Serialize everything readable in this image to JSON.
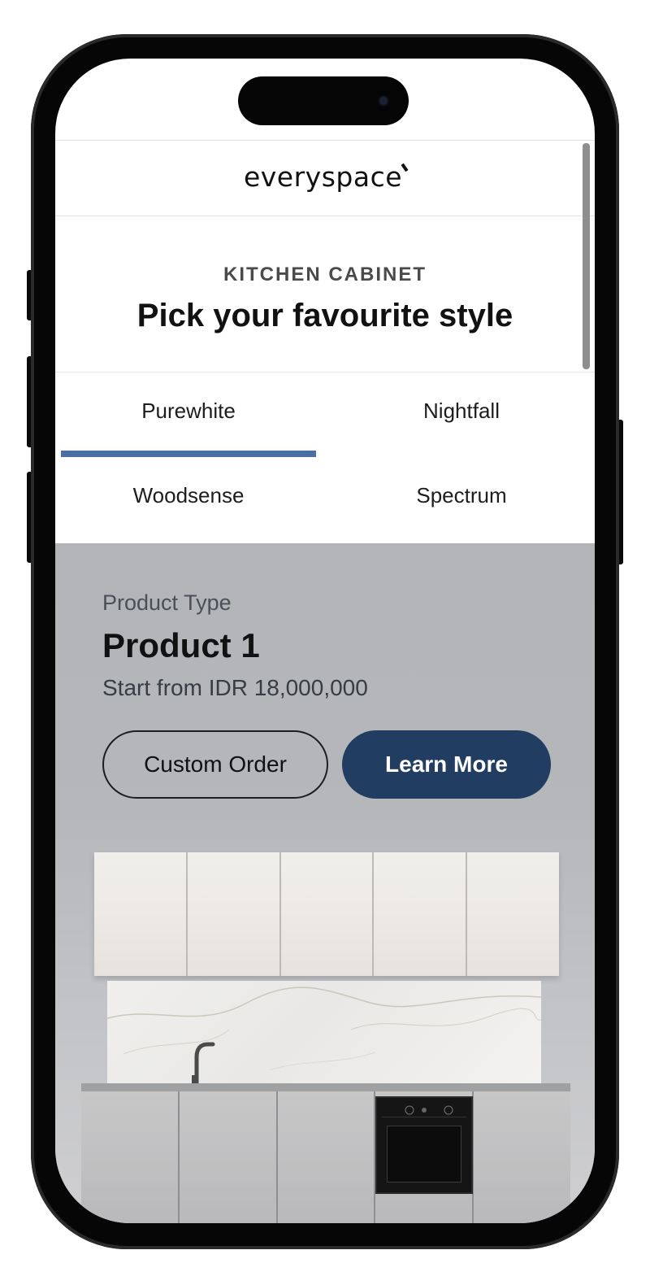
{
  "app": {
    "logo_text": "everyspace"
  },
  "intro": {
    "eyebrow": "KITCHEN CABINET",
    "headline": "Pick your favourite style"
  },
  "tabs": [
    {
      "label": "Purewhite",
      "active": true
    },
    {
      "label": "Nightfall",
      "active": false
    },
    {
      "label": "Woodsense",
      "active": false
    },
    {
      "label": "Spectrum",
      "active": false
    }
  ],
  "product": {
    "type_label": "Product Type",
    "name": "Product 1",
    "price_text": "Start from IDR 18,000,000",
    "buttons": {
      "custom_order": "Custom Order",
      "learn_more": "Learn More"
    }
  },
  "colors": {
    "accent_tab": "#4a6fa5",
    "primary_button": "#223d62",
    "product_bg": "#b5b7bb"
  },
  "icons": [
    "kitchen-image",
    "faucet-icon",
    "oven-icon"
  ]
}
